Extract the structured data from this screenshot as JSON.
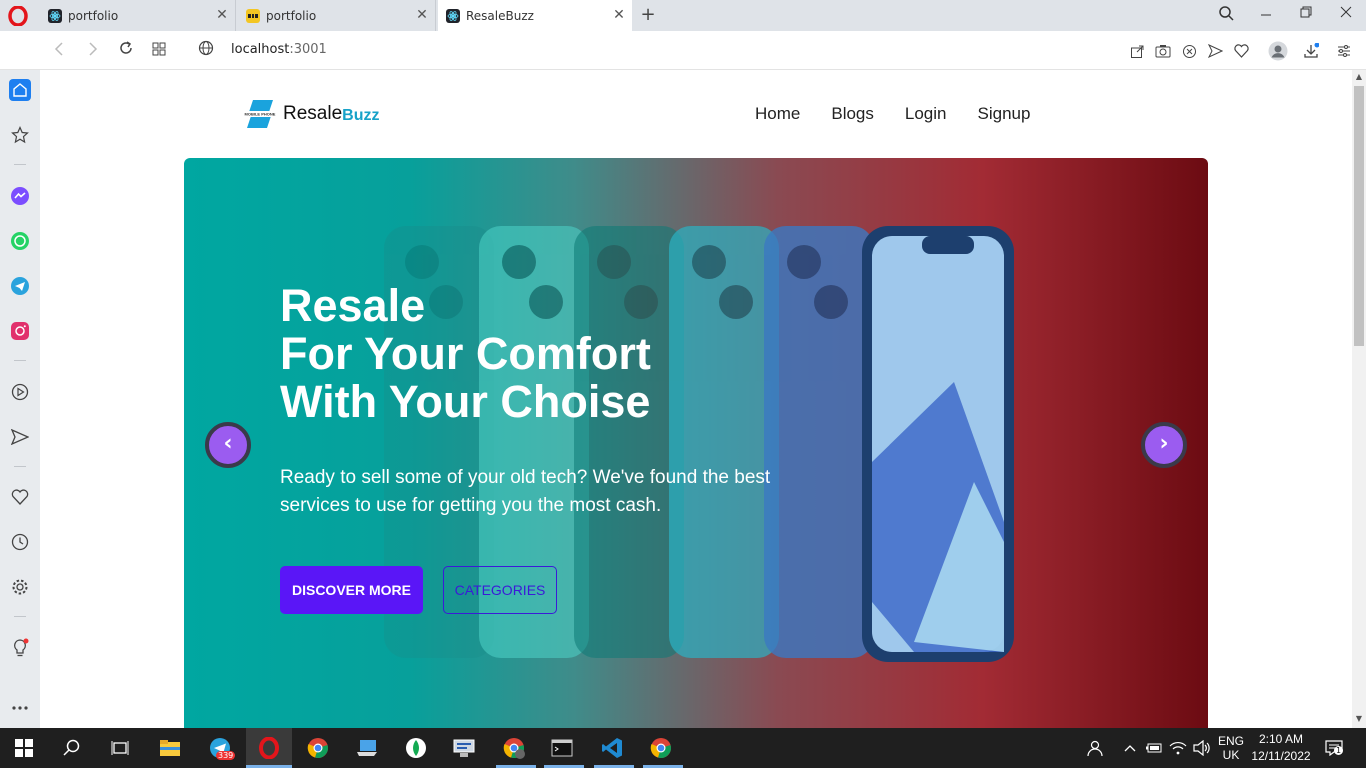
{
  "browser": {
    "tabs": [
      {
        "title": "portfolio",
        "favicon": "react-icon"
      },
      {
        "title": "portfolio",
        "favicon": "logo-yellow-icon"
      },
      {
        "title": "ResaleBuzz",
        "favicon": "react-icon"
      }
    ],
    "new_tab_label": "+",
    "url_host": "localhost",
    "url_port": ":3001"
  },
  "site": {
    "brand_main": "Resale",
    "brand_accent": "Buzz",
    "logo_tagline": "MOBILE PHONE",
    "nav": [
      "Home",
      "Blogs",
      "Login",
      "Signup"
    ]
  },
  "hero": {
    "title_lines": [
      "Resale",
      "For Your Comfort",
      "With Your Choise"
    ],
    "subtitle": "Ready to sell some of your old tech? We've found the best services to use for getting you the most cash.",
    "primary_button": "DISCOVER MORE",
    "secondary_button": "CATEGORIES",
    "prev_arrow": "‹",
    "next_arrow": "›"
  },
  "taskbar": {
    "telegram_badge": "339",
    "lang_top": "ENG",
    "lang_bottom": "UK",
    "time": "2:10 AM",
    "date": "12/11/2022",
    "notification_count": "1"
  },
  "colors": {
    "accent": "#5a16f7",
    "brand_accent": "#17a2c8",
    "arrow": "#9b5cf0"
  }
}
